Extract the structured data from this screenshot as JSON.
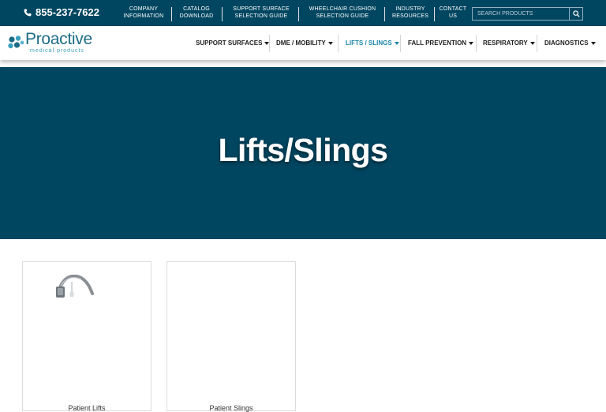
{
  "topbar": {
    "phone": "855-237-7622",
    "links": [
      {
        "line1": "COMPANY",
        "line2": "INFORMATION"
      },
      {
        "line1": "CATALOG",
        "line2": "DOWNLOAD"
      },
      {
        "line1": "SUPPORT SURFACE",
        "line2": "SELECTION GUIDE"
      },
      {
        "line1": "WHEELCHAIR CUSHION",
        "line2": "SELECTION GUIDE"
      },
      {
        "line1": "INDUSTRY",
        "line2": "RESOURCES"
      },
      {
        "line1": "CONTACT",
        "line2": "US"
      }
    ],
    "search_placeholder": "SEARCH PRODUCTS"
  },
  "brand": {
    "name": "Proactive",
    "tagline": "medical products"
  },
  "nav": {
    "items": [
      {
        "label": "SUPPORT SURFACES"
      },
      {
        "label": "DME / MOBILITY"
      },
      {
        "label": "LIFTS / SLINGS"
      },
      {
        "label": "FALL PREVENTION"
      },
      {
        "label": "RESPIRATORY"
      },
      {
        "label": "DIAGNOSTICS"
      }
    ],
    "active_index": 2
  },
  "hero": {
    "title": "Lifts/Slings"
  },
  "cards": [
    {
      "title": "Patient Lifts"
    },
    {
      "title": "Patient Slings"
    }
  ],
  "colors": {
    "brand_dark": "#004660",
    "accent": "#1b87a8"
  }
}
